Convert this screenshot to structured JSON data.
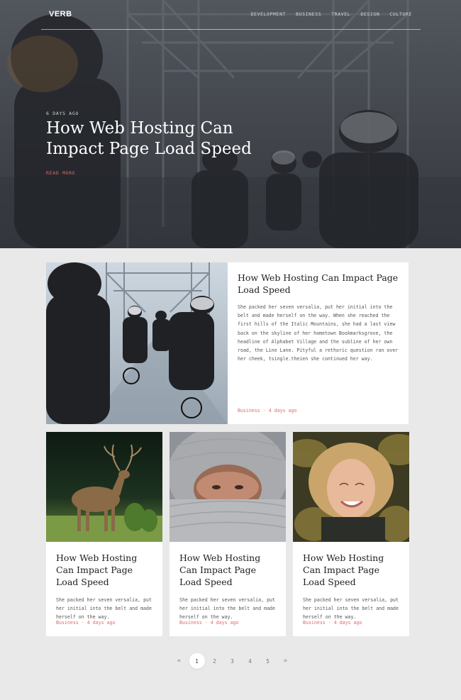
{
  "header": {
    "logo": "VERB",
    "nav": [
      "DEVELOPMENT",
      "BUSINESS",
      "TRAVEL",
      "DESIGN",
      "CULTURE"
    ]
  },
  "hero": {
    "meta": "6 DAYS AGO",
    "title": "How Web Hosting Can Impact Page Load Speed",
    "read_more": "READ MORE",
    "image_icon": "cyclists-bridge-image"
  },
  "featured": {
    "title": "How Web Hosting Can Impact Page Load Speed",
    "excerpt": "She packed her seven versalia, put her initial into the belt and made herself on the way. When she reached the first hills of the Italic Mountains, she had a last view back on the skyline of her hometown Bookmarksgrove, the headline of Alphabet Village and the subline of her own road, the Line Lane. Pityful a rethoric question ran over her cheek, tsingle.theien she continued her way.",
    "category": "Business",
    "time": "4 days ago",
    "image_icon": "cyclists-bridge-image"
  },
  "cards": [
    {
      "title": "How Web Hosting Can Impact Page Load Speed",
      "excerpt": "She packed her seven versalia, put her initial into the belt and made herself on the way.",
      "category": "Business",
      "time": "4 days ago",
      "image_icon": "deer-image"
    },
    {
      "title": "How Web Hosting Can Impact Page Load Speed",
      "excerpt": "She packed her seven versalia, put her initial into the belt and made herself on the way.",
      "category": "Business",
      "time": "4 days ago",
      "image_icon": "woman-knit-hood-image"
    },
    {
      "title": "How Web Hosting Can Impact Page Load Speed",
      "excerpt": "She packed her seven versalia, put her initial into the belt and made herself on the way.",
      "category": "Business",
      "time": "4 days ago",
      "image_icon": "smiling-woman-image"
    }
  ],
  "pagination": {
    "prev": "«",
    "pages": [
      "1",
      "2",
      "3",
      "4",
      "5"
    ],
    "next": "»",
    "current": "1"
  },
  "colors": {
    "accent": "#e06b6b",
    "background": "#e9e9e9",
    "card": "#ffffff",
    "hero_overlay": "#3a3d44"
  }
}
